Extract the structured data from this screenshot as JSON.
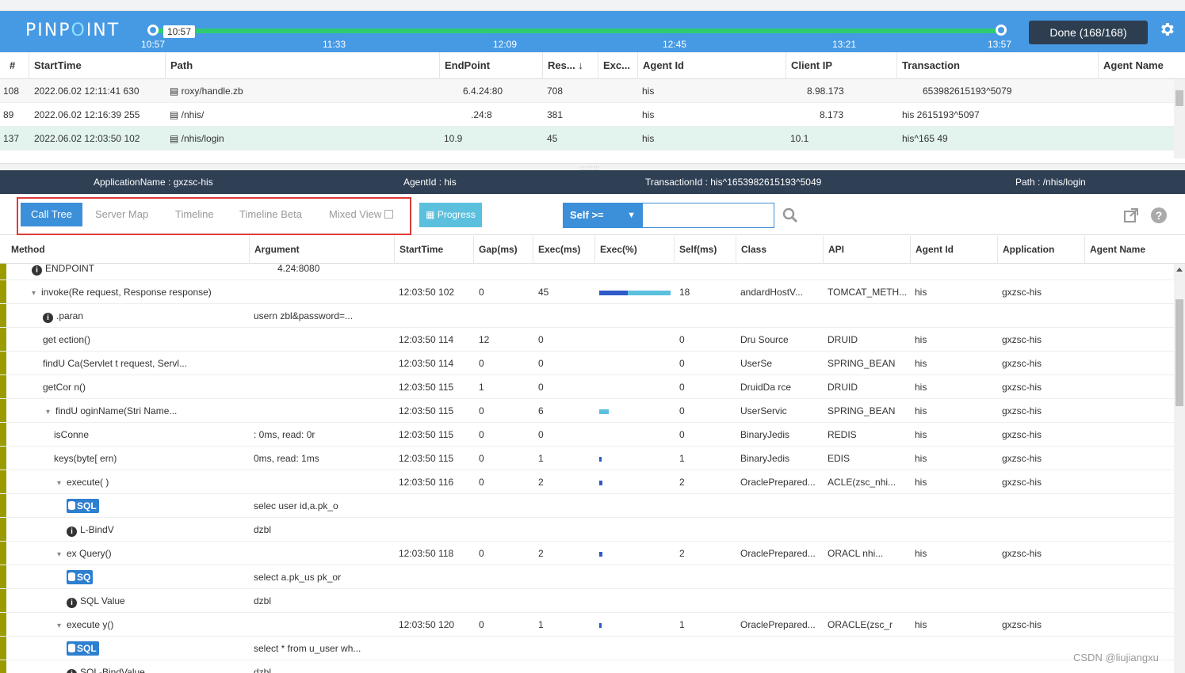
{
  "app": {
    "logo_pre": "PINP",
    "logo_dot": "O",
    "logo_post": "INT"
  },
  "timeline": {
    "tooltip": "10:57",
    "ticks": [
      "10:57",
      "11:33",
      "12:09",
      "12:45",
      "13:21",
      "13:57"
    ],
    "done_label": "Done (168/168)"
  },
  "tx": {
    "headers": [
      "#",
      "StartTime",
      "Path",
      "EndPoint",
      "Res... ↓",
      "Exc...",
      "Agent Id",
      "Client IP",
      "Transaction",
      "Agent Name"
    ],
    "rows": [
      {
        "num": "108",
        "start": "2022.06.02 12:11:41 630",
        "path": "roxy/handle.zb",
        "endpoint": "6.4.24:80",
        "res": "708",
        "agent": "his",
        "ip": "8.98.173",
        "tx": "653982615193^5079"
      },
      {
        "num": "89",
        "start": "2022.06.02 12:16:39 255",
        "path": "/nhis/",
        "endpoint": ".24:8",
        "res": "381",
        "agent": "his",
        "ip": "8.173",
        "tx": "his 2615193^5097"
      },
      {
        "num": "137",
        "start": "2022.06.02 12:03:50 102",
        "path": "/nhis/login",
        "endpoint": "10.9",
        "res": "45",
        "agent": "his",
        "ip": "10.1",
        "tx": "his^165 49"
      }
    ]
  },
  "info": {
    "app": "ApplicationName : gxzsc-his",
    "agent": "AgentId : his",
    "txid": "TransactionId : his^1653982615193^5049",
    "path": "Path : /nhis/login"
  },
  "toolbar": {
    "tabs": [
      "Call Tree",
      "Server Map",
      "Timeline",
      "Timeline Beta",
      "Mixed View"
    ],
    "progress": "Progress",
    "self_label": "Self >=",
    "self_value": ""
  },
  "calltree": {
    "headers": [
      "Method",
      "Argument",
      "StartTime",
      "Gap(ms)",
      "Exec(ms)",
      "Exec(%)",
      "Self(ms)",
      "Class",
      "API",
      "Agent Id",
      "Application",
      "Agent Name"
    ],
    "endpoint_label": "ENDPOINT",
    "endpoint_arg": "4.24:8080",
    "rows": [
      {
        "method": "invoke(Re request, Response response)",
        "arg": "",
        "start": "12:03:50 102",
        "gap": "0",
        "exec": "45",
        "pct": 100,
        "self": "18",
        "cls": "andardHostV...",
        "api": "TOMCAT_METH...",
        "agent": "his",
        "app": "gxzsc-his"
      },
      {
        "method": ".paran",
        "arg": "usern zbl&password=...",
        "start": "",
        "gap": "",
        "exec": "",
        "pct": 0,
        "self": "",
        "cls": "",
        "api": "",
        "agent": "",
        "app": ""
      },
      {
        "method": "get ection()",
        "arg": "",
        "start": "12:03:50 114",
        "gap": "12",
        "exec": "0",
        "pct": 0,
        "self": "0",
        "cls": "Dru Source",
        "api": "DRUID",
        "agent": "his",
        "app": "gxzsc-his"
      },
      {
        "method": "findU Ca(Servlet t request, Servl...",
        "arg": "",
        "start": "12:03:50 114",
        "gap": "0",
        "exec": "0",
        "pct": 0,
        "self": "0",
        "cls": "UserSe",
        "api": "SPRING_BEAN",
        "agent": "his",
        "app": "gxzsc-his"
      },
      {
        "method": "getCor n()",
        "arg": "",
        "start": "12:03:50 115",
        "gap": "1",
        "exec": "0",
        "pct": 0,
        "self": "0",
        "cls": "DruidDa rce",
        "api": "DRUID",
        "agent": "his",
        "app": "gxzsc-his"
      },
      {
        "method": "findU oginName(Stri Name...",
        "arg": "",
        "start": "12:03:50 115",
        "gap": "0",
        "exec": "6",
        "pct": 13,
        "self": "0",
        "cls": "UserServic",
        "api": "SPRING_BEAN",
        "agent": "his",
        "app": "gxzsc-his"
      },
      {
        "method": "isConne",
        "arg": ": 0ms, read: 0r",
        "start": "12:03:50 115",
        "gap": "0",
        "exec": "0",
        "pct": 0,
        "self": "0",
        "cls": "BinaryJedis",
        "api": "REDIS",
        "agent": "his",
        "app": "gxzsc-his"
      },
      {
        "method": "keys(byte[ ern)",
        "arg": "0ms, read: 1ms",
        "start": "12:03:50 115",
        "gap": "0",
        "exec": "1",
        "pct": 2,
        "self": "1",
        "cls": "BinaryJedis",
        "api": "EDIS",
        "agent": "his",
        "app": "gxzsc-his"
      },
      {
        "method": "execute( )",
        "arg": "",
        "start": "12:03:50 116",
        "gap": "0",
        "exec": "2",
        "pct": 4,
        "self": "2",
        "cls": "OraclePrepared...",
        "api": "ACLE(zsc_nhi...",
        "agent": "his",
        "app": "gxzsc-his"
      },
      {
        "method": "SQL",
        "arg": "selec user id,a.pk_o",
        "start": "",
        "gap": "",
        "exec": "",
        "pct": 0,
        "self": "",
        "cls": "",
        "api": "",
        "agent": "",
        "app": ""
      },
      {
        "method": "L-BindV",
        "arg": "dzbl",
        "start": "",
        "gap": "",
        "exec": "",
        "pct": 0,
        "self": "",
        "cls": "",
        "api": "",
        "agent": "",
        "app": ""
      },
      {
        "method": "ex Query()",
        "arg": "",
        "start": "12:03:50 118",
        "gap": "0",
        "exec": "2",
        "pct": 4,
        "self": "2",
        "cls": "OraclePrepared...",
        "api": "ORACL nhi...",
        "agent": "his",
        "app": "gxzsc-his"
      },
      {
        "method": "SQ",
        "arg": "select a.pk_us pk_or",
        "start": "",
        "gap": "",
        "exec": "",
        "pct": 0,
        "self": "",
        "cls": "",
        "api": "",
        "agent": "",
        "app": ""
      },
      {
        "method": "SQL Value",
        "arg": "dzbl",
        "start": "",
        "gap": "",
        "exec": "",
        "pct": 0,
        "self": "",
        "cls": "",
        "api": "",
        "agent": "",
        "app": ""
      },
      {
        "method": "execute y()",
        "arg": "",
        "start": "12:03:50 120",
        "gap": "0",
        "exec": "1",
        "pct": 2,
        "self": "1",
        "cls": "OraclePrepared...",
        "api": "ORACLE(zsc_r",
        "agent": "his",
        "app": "gxzsc-his"
      },
      {
        "method": "SQL",
        "arg": "select * from u_user wh...",
        "start": "",
        "gap": "",
        "exec": "",
        "pct": 0,
        "self": "",
        "cls": "",
        "api": "",
        "agent": "",
        "app": ""
      },
      {
        "method": "SQL-BindValue",
        "arg": "dzbl",
        "start": "",
        "gap": "",
        "exec": "",
        "pct": 0,
        "self": "",
        "cls": "",
        "api": "",
        "agent": "",
        "app": ""
      }
    ]
  },
  "watermark": "CSDN @liujiangxu",
  "colors": {
    "header_bg": "#469ae4",
    "timeline": "#2ecc71",
    "info_bg": "#2f3f54",
    "active_tab": "#3c8fd9",
    "highlight_box": "#e03a3a"
  }
}
